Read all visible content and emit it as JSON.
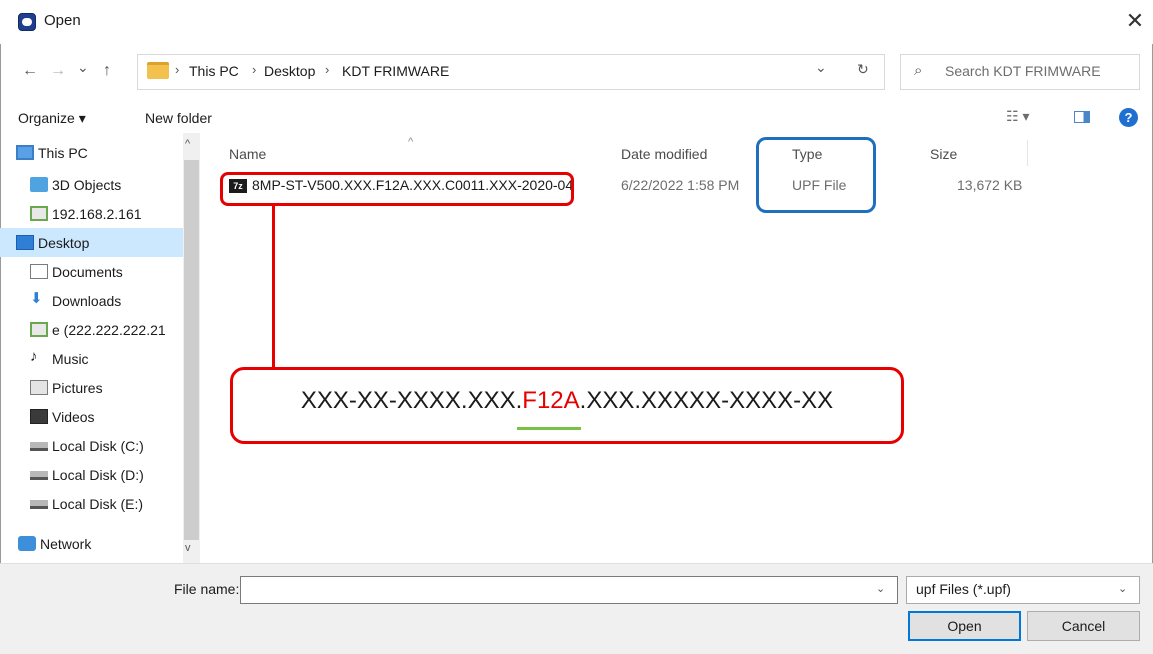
{
  "window": {
    "title": "Open",
    "close_symbol": "✕"
  },
  "nav": {
    "back": "←",
    "forward": "→",
    "recent": "⌄",
    "up": "↑"
  },
  "address": {
    "crumbs": [
      "This PC",
      "Desktop",
      "KDT FRIMWARE"
    ],
    "separator": "›",
    "dropdown": "⌄",
    "refresh": "↻"
  },
  "search": {
    "placeholder": "Search KDT FRIMWARE",
    "icon": "⌕"
  },
  "toolbar": {
    "organize": "Organize ▾",
    "new_folder": "New folder",
    "view": "☷ ▾",
    "help": "?"
  },
  "sidebar": {
    "items": [
      {
        "label": "This PC",
        "icon": "monitor-icon"
      },
      {
        "label": "3D Objects",
        "icon": "cube-icon"
      },
      {
        "label": "192.168.2.161",
        "icon": "network-drive-icon"
      },
      {
        "label": "Desktop",
        "icon": "desktop-icon",
        "selected": true
      },
      {
        "label": "Documents",
        "icon": "document-icon"
      },
      {
        "label": "Downloads",
        "icon": "download-icon"
      },
      {
        "label": "e (222.222.222.21",
        "icon": "network-drive-icon"
      },
      {
        "label": "Music",
        "icon": "music-icon"
      },
      {
        "label": "Pictures",
        "icon": "pictures-icon"
      },
      {
        "label": "Videos",
        "icon": "video-icon"
      },
      {
        "label": "Local Disk (C:)",
        "icon": "disk-icon"
      },
      {
        "label": "Local Disk (D:)",
        "icon": "disk-icon"
      },
      {
        "label": "Local Disk (E:)",
        "icon": "disk-icon"
      },
      {
        "label": "Network",
        "icon": "network-icon"
      }
    ],
    "scroll_up": "^",
    "scroll_down": "v"
  },
  "file_list": {
    "columns": [
      "Name",
      "Date modified",
      "Type",
      "Size"
    ],
    "sort_indicator": "^",
    "rows": [
      {
        "icon_text": "7z",
        "name": "8MP-ST-V500.XXX.F12A.XXX.C0011.XXX-2020-04",
        "date": "6/22/2022 1:58 PM",
        "type": "UPF File",
        "size": "13,672 KB"
      }
    ]
  },
  "annotation": {
    "prefix": "XXX-XX-XXXX.XXX.",
    "highlight": "F12A",
    "suffix": ".XXX.XXXXX-XXXX-XX",
    "colors": {
      "box": "#e60000",
      "type_box": "#1f6fbf",
      "underline": "#7ac043"
    }
  },
  "bottom": {
    "file_name_label": "File name:",
    "file_name_value": "",
    "file_type": "upf Files (*.upf)",
    "caret": "⌄",
    "open": "Open",
    "cancel": "Cancel"
  }
}
